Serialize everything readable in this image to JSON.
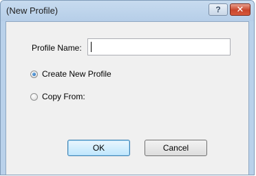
{
  "window": {
    "title": "(New Profile)",
    "help_label": "?",
    "close_label": "✕"
  },
  "form": {
    "profile_name_label": "Profile Name:",
    "profile_name_value": "",
    "options": [
      {
        "label": "Create New Profile",
        "checked": true
      },
      {
        "label": "Copy From:",
        "checked": false
      }
    ]
  },
  "buttons": {
    "ok": "OK",
    "cancel": "Cancel"
  }
}
